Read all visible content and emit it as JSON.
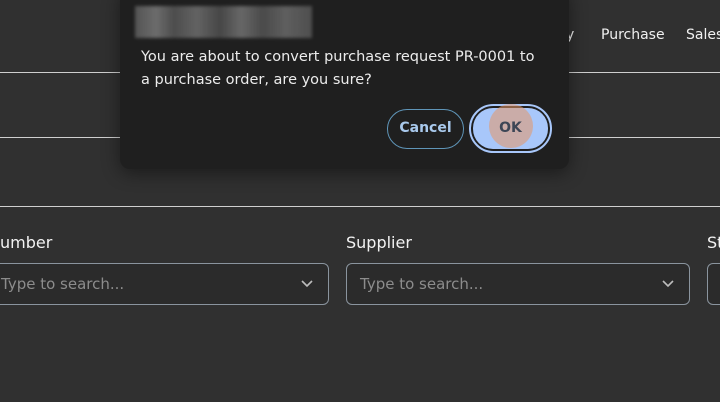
{
  "nav": {
    "inventory_fragment": "y",
    "purchase": "Purchase",
    "sales": "Sales"
  },
  "filters": {
    "number_label": "umber",
    "number_placeholder": "Type to search...",
    "supplier_label": "Supplier",
    "supplier_placeholder": "Type to search...",
    "status_label": "St"
  },
  "dialog": {
    "message": "You are about to convert purchase request PR-0001 to a purchase order, are you sure?",
    "cancel_label": "Cancel",
    "ok_label": "OK"
  },
  "colors": {
    "background": "#303030",
    "dialog_bg": "#1f1f1f",
    "primary_button": "#a8c7fa",
    "outline_button_border": "#5f95b8"
  },
  "icons": {
    "dropdown": "chevron-down-icon"
  }
}
